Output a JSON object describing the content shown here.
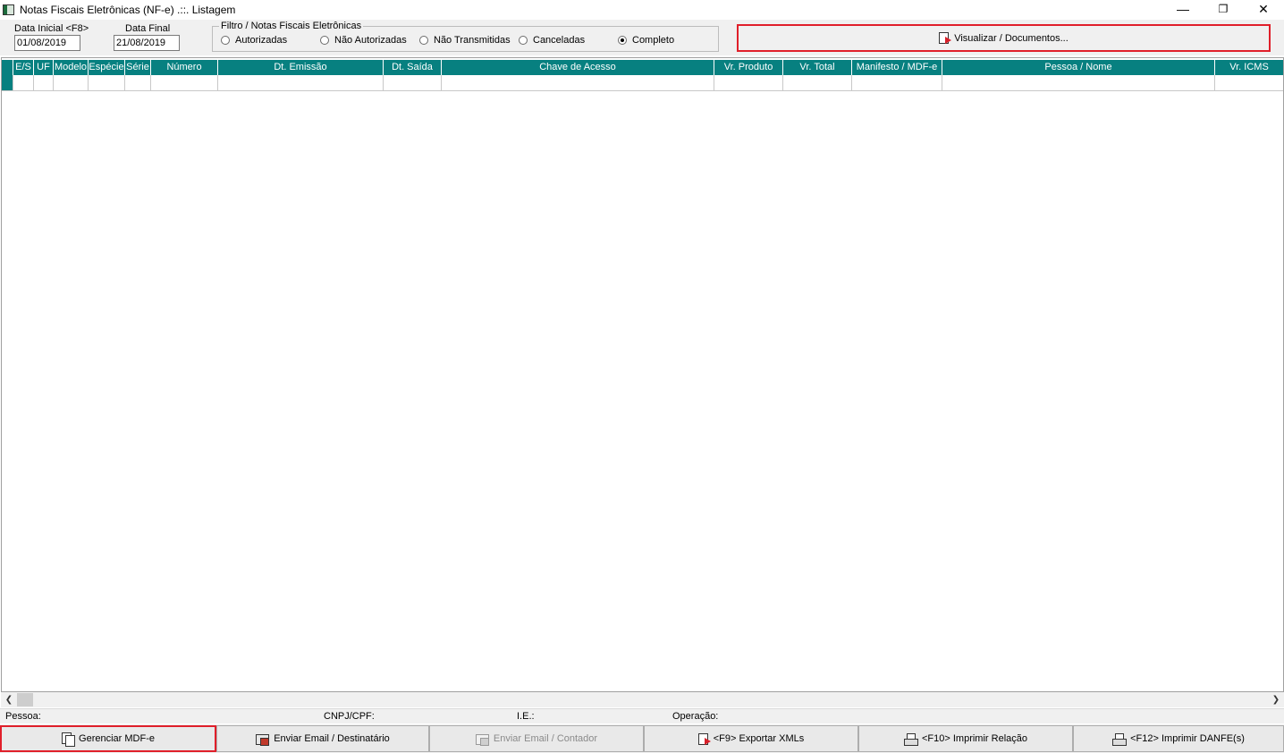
{
  "window": {
    "title": "Notas Fiscais Eletrônicas (NF-e) .::. Listagem",
    "controls": {
      "minimize": "—",
      "restore": "❐",
      "close": "✕"
    },
    "app_icon": "app-window-icon"
  },
  "filters": {
    "start_date_label": "Data Inicial <F8>",
    "start_date_value": "01/08/2019",
    "end_date_label": "Data Final",
    "end_date_value": "21/08/2019",
    "group_label": "Filtro / Notas Fiscais Eletrônicas",
    "options": [
      {
        "label": "Autorizadas",
        "checked": false
      },
      {
        "label": "Não Autorizadas",
        "checked": false
      },
      {
        "label": "Não Transmitidas",
        "checked": false
      },
      {
        "label": "Canceladas",
        "checked": false
      },
      {
        "label": "Completo",
        "checked": true
      }
    ]
  },
  "view_button": {
    "label": "Visualizar / Documentos...",
    "icon": "document-arrow-icon"
  },
  "grid": {
    "columns": [
      "",
      "E/S",
      "UF",
      "Modelo",
      "Espécie",
      "Série",
      "Número",
      "Dt. Emissão",
      "Dt. Saída",
      "Chave de Acesso",
      "Vr. Produto",
      "Vr. Total",
      "Manifesto / MDF-e",
      "Pessoa / Nome",
      "Vr. ICMS"
    ],
    "rows": []
  },
  "status": {
    "pessoa_label": "Pessoa:",
    "cnpj_label": "CNPJ/CPF:",
    "ie_label": "I.E.:",
    "operacao_label": "Operação:"
  },
  "bottom_buttons": [
    {
      "label": "Gerenciar MDF-e",
      "icon": "documents-icon",
      "enabled": true,
      "highlighted": true
    },
    {
      "label": "Enviar Email / Destinatário",
      "icon": "email-icon",
      "enabled": true
    },
    {
      "label": "Enviar Email / Contador",
      "icon": "email-icon",
      "enabled": false
    },
    {
      "label": "<F9> Exportar XMLs",
      "icon": "document-arrow-icon",
      "enabled": true
    },
    {
      "label": "<F10> Imprimir Relação",
      "icon": "printer-icon",
      "enabled": true
    },
    {
      "label": "<F12> Imprimir DANFE(s)",
      "icon": "printer-icon",
      "enabled": true
    }
  ],
  "colors": {
    "grid_header": "#078080",
    "highlight_border": "#e01f2a",
    "toolbar_bg": "#f0f0f0"
  }
}
